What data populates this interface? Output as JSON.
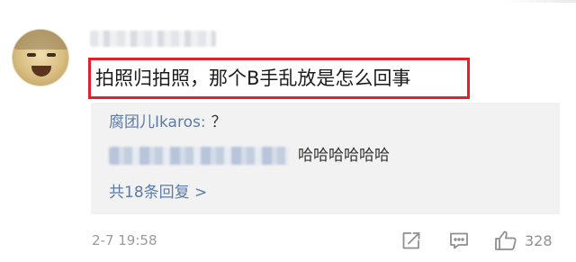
{
  "comment": {
    "text": "拍照归拍照，那个B手乱放是怎么回事",
    "timestamp": "2-7 19:58",
    "likes": "328"
  },
  "replies": [
    {
      "author": "腐团儿Ikaros:",
      "text": "？"
    },
    {
      "text": "哈哈哈哈哈哈"
    }
  ],
  "more_replies_label": "共18条回复 >",
  "colors": {
    "link_blue": "#5b7ba8",
    "highlight_red": "#e0212d",
    "reply_bg": "#f2f2f2",
    "meta_gray": "#9b9b9b"
  },
  "icons": {
    "share": "share-icon",
    "reply": "comment-icon",
    "like": "thumbs-up-icon"
  }
}
